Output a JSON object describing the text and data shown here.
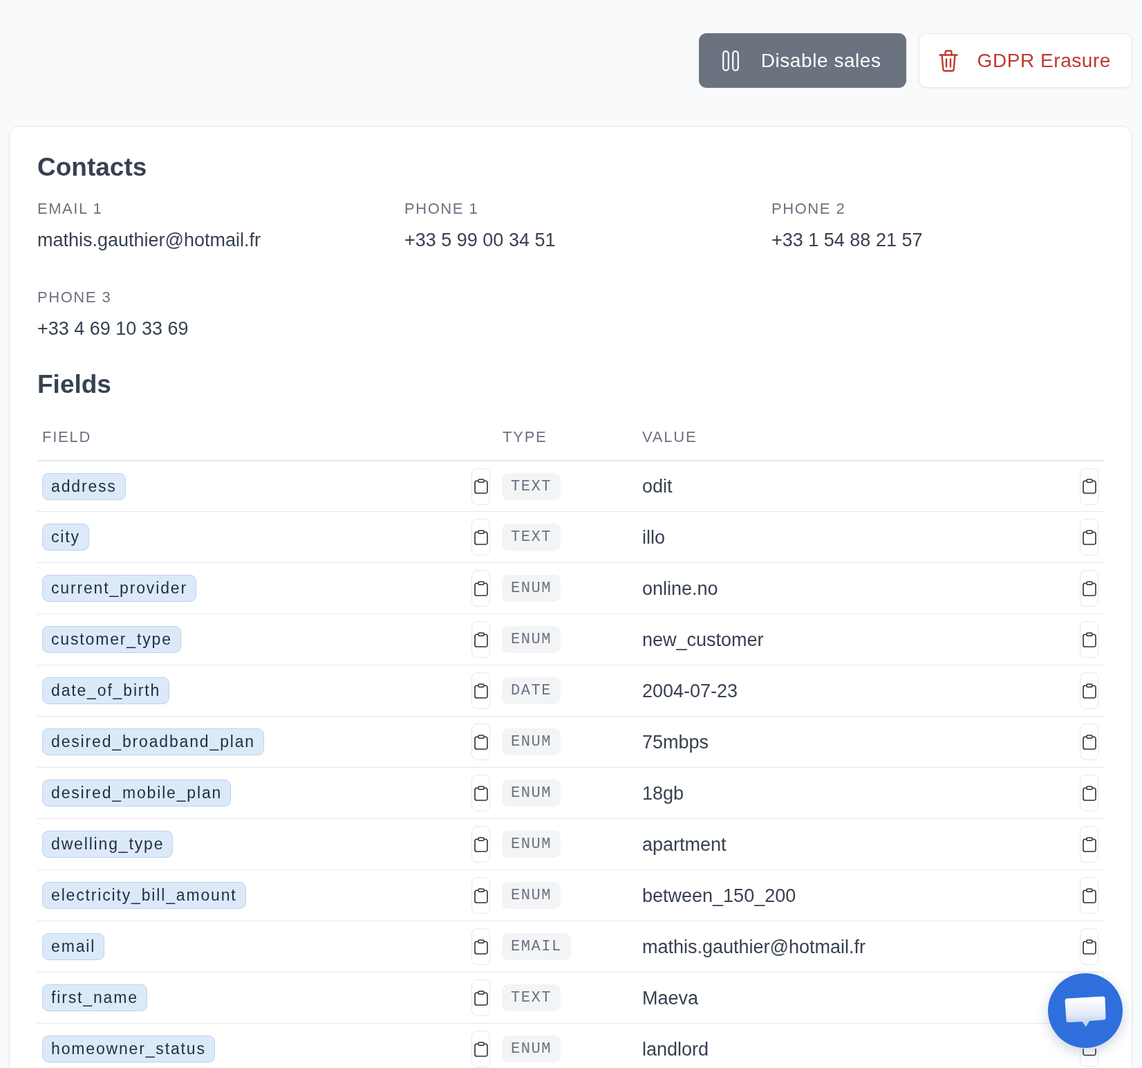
{
  "toolbar": {
    "buttons": [
      {
        "kind": "pause",
        "label": "Disable sales"
      },
      {
        "kind": "erase",
        "label": "GDPR Erasure"
      }
    ]
  },
  "contacts": {
    "title": "Contacts",
    "items": [
      {
        "label": "EMAIL 1",
        "value": "mathis.gauthier@hotmail.fr"
      },
      {
        "label": "PHONE 1",
        "value": "+33 5 99 00 34 51"
      },
      {
        "label": "PHONE 2",
        "value": "+33 1 54 88 21 57"
      },
      {
        "label": "PHONE 3",
        "value": "+33 4 69 10 33 69"
      }
    ]
  },
  "fields": {
    "title": "Fields",
    "columns": [
      "FIELD",
      "TYPE",
      "VALUE"
    ],
    "rows": [
      {
        "field": "address",
        "type": "TEXT",
        "value": "odit"
      },
      {
        "field": "city",
        "type": "TEXT",
        "value": "illo"
      },
      {
        "field": "current_provider",
        "type": "ENUM",
        "value": "online.no"
      },
      {
        "field": "customer_type",
        "type": "ENUM",
        "value": "new_customer"
      },
      {
        "field": "date_of_birth",
        "type": "DATE",
        "value": "2004-07-23"
      },
      {
        "field": "desired_broadband_plan",
        "type": "ENUM",
        "value": "75mbps"
      },
      {
        "field": "desired_mobile_plan",
        "type": "ENUM",
        "value": "18gb"
      },
      {
        "field": "dwelling_type",
        "type": "ENUM",
        "value": "apartment"
      },
      {
        "field": "electricity_bill_amount",
        "type": "ENUM",
        "value": "between_150_200"
      },
      {
        "field": "email",
        "type": "EMAIL",
        "value": "mathis.gauthier@hotmail.fr"
      },
      {
        "field": "first_name",
        "type": "TEXT",
        "value": "Maeva"
      },
      {
        "field": "homeowner_status",
        "type": "ENUM",
        "value": "landlord"
      }
    ]
  }
}
